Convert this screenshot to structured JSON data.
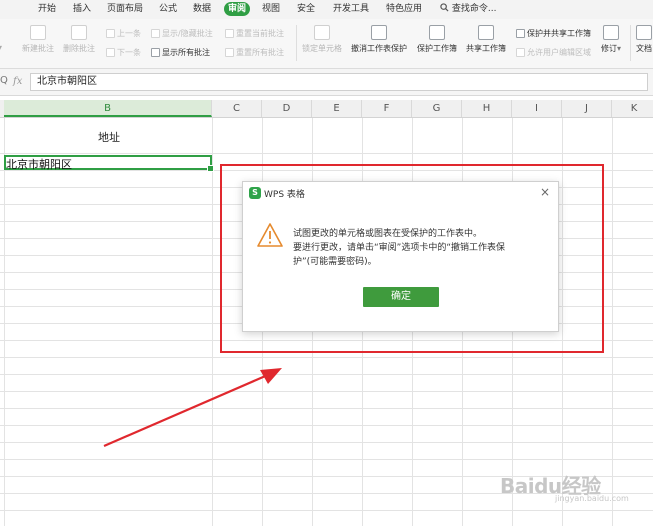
{
  "menu": {
    "items": [
      "开始",
      "插入",
      "页面布局",
      "公式",
      "数据",
      "审阅",
      "视图",
      "安全",
      "开发工具",
      "特色应用"
    ],
    "active": "审阅",
    "search_label": "查找命令..."
  },
  "ribbon": {
    "new_comment": "新建批注",
    "delete_comment": "删除批注",
    "prev": "上一条",
    "next": "下一条",
    "show_hide_comment": "显示/隐藏批注",
    "show_all_comments": "显示所有批注",
    "reset_current_comment": "重置当前批注",
    "reset_all_comments": "重置所有批注",
    "lock_cell": "锁定单元格",
    "unprotect_sheet": "撤消工作表保护",
    "protect_sheet": "保护工作簿",
    "share_workbook": "共享工作簿",
    "protect_and_share": "保护并共享工作簿",
    "allow_edit_ranges": "允许用户编辑区域",
    "revise": "修订",
    "document": "文档"
  },
  "formula_bar": {
    "fx": "fx",
    "value": "北京市朝阳区"
  },
  "columns": [
    "B",
    "C",
    "D",
    "E",
    "F",
    "G",
    "H",
    "I",
    "J",
    "K"
  ],
  "selected_column": "B",
  "sheet": {
    "header_cell": "地址",
    "active_cell_value": "北京市朝阳区"
  },
  "dialog": {
    "title": "WPS 表格",
    "logo": "S",
    "close": "×",
    "line1": "试图更改的单元格或图表在受保护的工作表中。",
    "line2": "要进行更改，请单击“审阅”选项卡中的“撤销工作表保",
    "line3": "护”(可能需要密码)。",
    "ok": "确定"
  },
  "watermark": {
    "brand": "Baidu经验",
    "url": "jingyan.baidu.com"
  },
  "colors": {
    "accent": "#2f9e44",
    "highlight_red": "#e0282e",
    "ok_button": "#3f9b3d"
  }
}
